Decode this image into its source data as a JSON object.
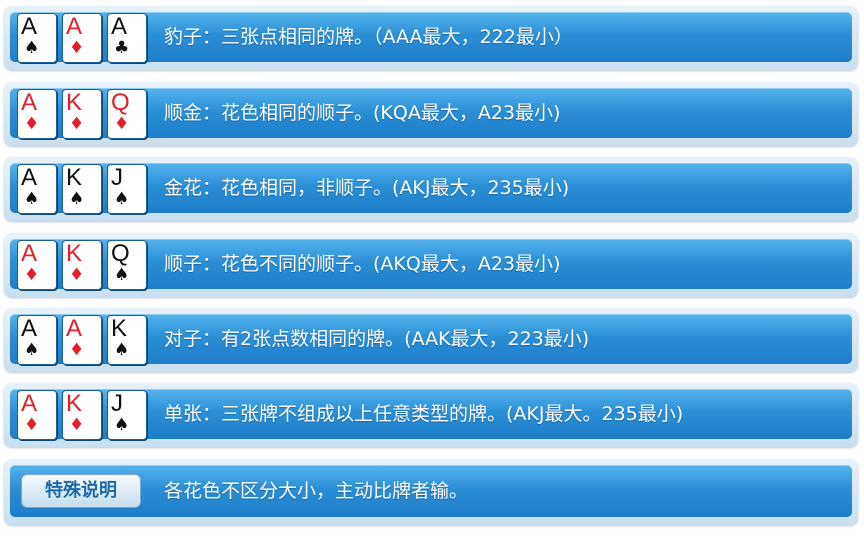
{
  "rules": [
    {
      "cards": [
        {
          "rank": "A",
          "suit": "♠",
          "color": "black"
        },
        {
          "rank": "A",
          "suit": "♦",
          "color": "red"
        },
        {
          "rank": "A",
          "suit": "♣",
          "color": "black"
        }
      ],
      "text": "豹子：三张点相同的牌。（AAA最大，222最小）"
    },
    {
      "cards": [
        {
          "rank": "A",
          "suit": "♦",
          "color": "red"
        },
        {
          "rank": "K",
          "suit": "♦",
          "color": "red"
        },
        {
          "rank": "Q",
          "suit": "♦",
          "color": "red"
        }
      ],
      "text": "顺金：花色相同的顺子。(KQA最大，A23最小)"
    },
    {
      "cards": [
        {
          "rank": "A",
          "suit": "♠",
          "color": "black"
        },
        {
          "rank": "K",
          "suit": "♠",
          "color": "black"
        },
        {
          "rank": "J",
          "suit": "♠",
          "color": "black"
        }
      ],
      "text": "金花：花色相同，非顺子。(AKJ最大，235最小)"
    },
    {
      "cards": [
        {
          "rank": "A",
          "suit": "♦",
          "color": "red"
        },
        {
          "rank": "K",
          "suit": "♦",
          "color": "red"
        },
        {
          "rank": "Q",
          "suit": "♠",
          "color": "black"
        }
      ],
      "text": "顺子：花色不同的顺子。(AKQ最大，A23最小)"
    },
    {
      "cards": [
        {
          "rank": "A",
          "suit": "♠",
          "color": "black"
        },
        {
          "rank": "A",
          "suit": "♦",
          "color": "red"
        },
        {
          "rank": "K",
          "suit": "♠",
          "color": "black"
        }
      ],
      "text": "对子：有2张点数相同的牌。(AAK最大，223最小)"
    },
    {
      "cards": [
        {
          "rank": "A",
          "suit": "♦",
          "color": "red"
        },
        {
          "rank": "K",
          "suit": "♦",
          "color": "red"
        },
        {
          "rank": "J",
          "suit": "♠",
          "color": "black"
        }
      ],
      "text": "单张：三张牌不组成以上任意类型的牌。(AKJ最大。235最小)"
    }
  ],
  "special": {
    "button_label": "特殊说明",
    "text": "各花色不区分大小，主动比牌者输。"
  },
  "colors": {
    "red_suit": "#e0202a",
    "black_suit": "#111111",
    "panel_blue": "#2c8fd6"
  }
}
